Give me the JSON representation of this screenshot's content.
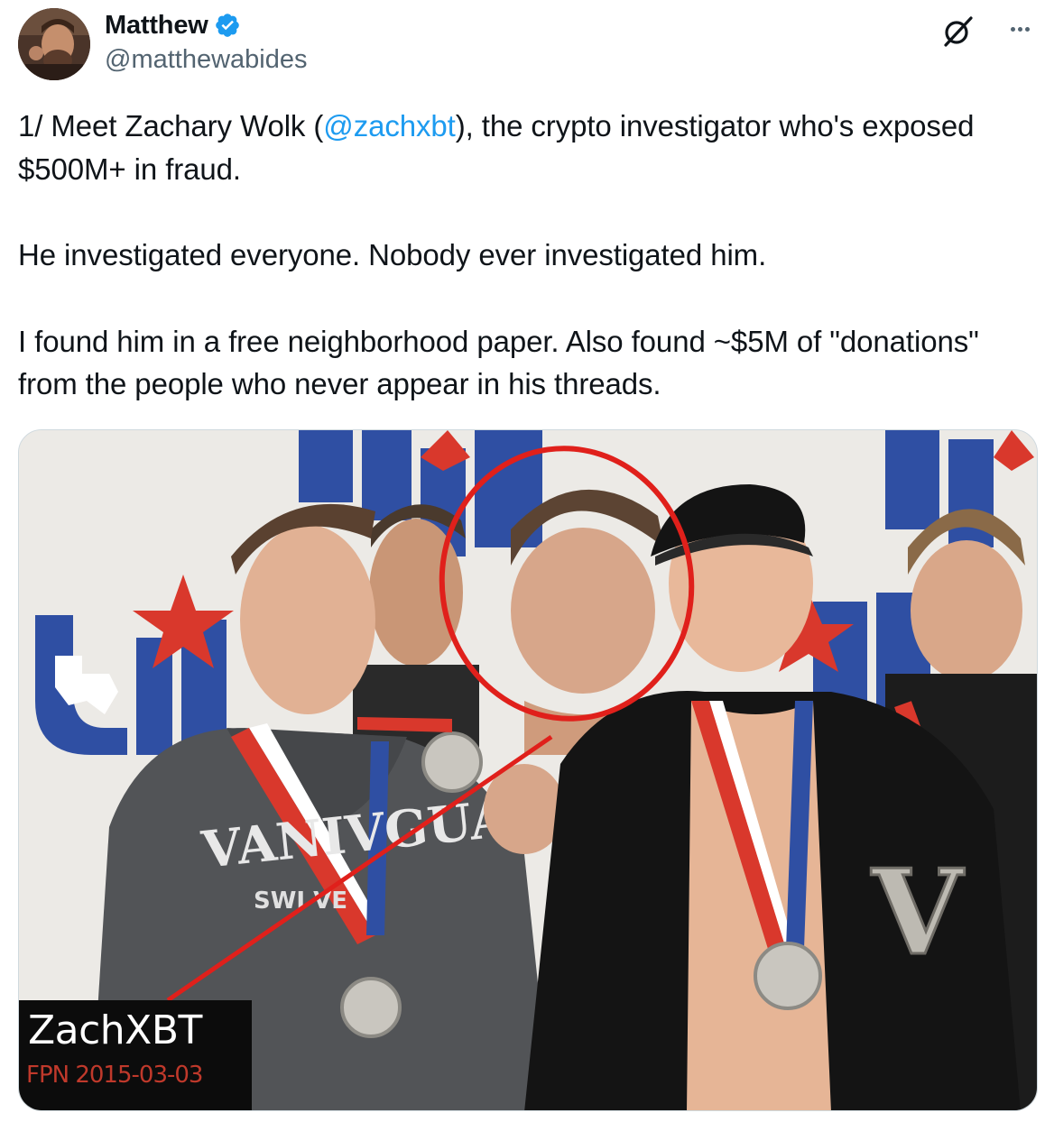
{
  "author": {
    "name": "Matthew",
    "handle": "@matthewabides",
    "verified": true,
    "avatar_icon": "profile-photo"
  },
  "actions": {
    "grok_icon": "grok-icon",
    "more_icon": "more-horizontal-icon"
  },
  "tweet": {
    "line1_before": "1/ Meet Zachary Wolk (",
    "mention": "@zachxbt",
    "line1_after": "), the crypto investigator who's exposed $500M+ in fraud.",
    "paragraph2": "He investigated everyone. Nobody ever investigated him.",
    "paragraph3": "I found him in a free neighborhood paper. Also found ~$5M of \"donations\" from the people who never appear in his threads."
  },
  "media": {
    "caption_title": "ZachXBT",
    "caption_sub": "FPN 2015-03-03",
    "sweatshirt_text": "VANIVGUAFT",
    "sweatshirt_sub": "SWI VE",
    "jacket_letter": "V"
  },
  "colors": {
    "link": "#1d9bf0",
    "verified": "#1d9bf0",
    "annotation_red": "#e0201b",
    "handle": "#536471"
  }
}
